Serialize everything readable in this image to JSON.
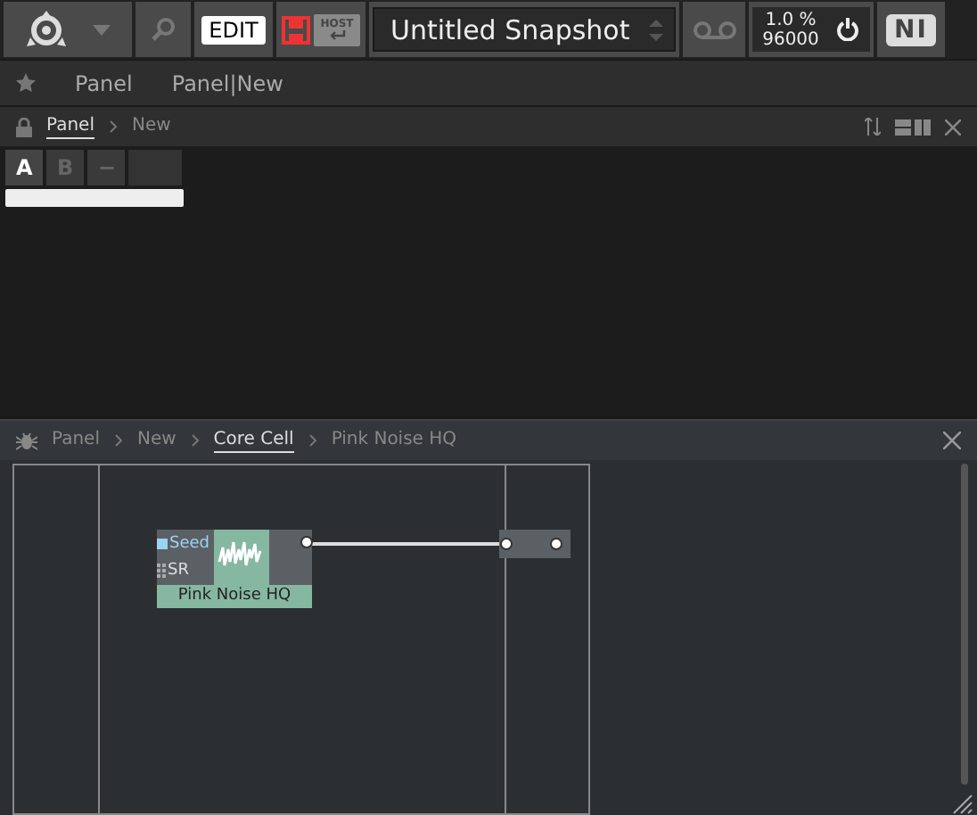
{
  "toolbar": {
    "edit_label": "EDIT",
    "host_label": "HOST",
    "snapshot": "Untitled Snapshot",
    "cpu": "1.0 %",
    "sample_rate": "96000",
    "logo": "NI"
  },
  "favorites": [
    "Panel",
    "Panel|New"
  ],
  "panel_view": {
    "breadcrumbs": [
      {
        "label": "Panel",
        "selected": true
      },
      {
        "label": "New",
        "selected": false
      }
    ],
    "tabs": [
      {
        "label": "A",
        "selected": true
      },
      {
        "label": "B",
        "selected": false
      },
      {
        "label": "−",
        "selected": false
      }
    ]
  },
  "structure_view": {
    "breadcrumbs": [
      {
        "label": "Panel",
        "selected": false
      },
      {
        "label": "New",
        "selected": false
      },
      {
        "label": "Core Cell",
        "selected": true
      },
      {
        "label": "Pink Noise HQ",
        "selected": false
      }
    ],
    "module": {
      "name": "Pink Noise HQ",
      "ports": [
        {
          "label": "Seed",
          "kind": "event"
        },
        {
          "label": "SR",
          "kind": "audio"
        }
      ]
    }
  }
}
